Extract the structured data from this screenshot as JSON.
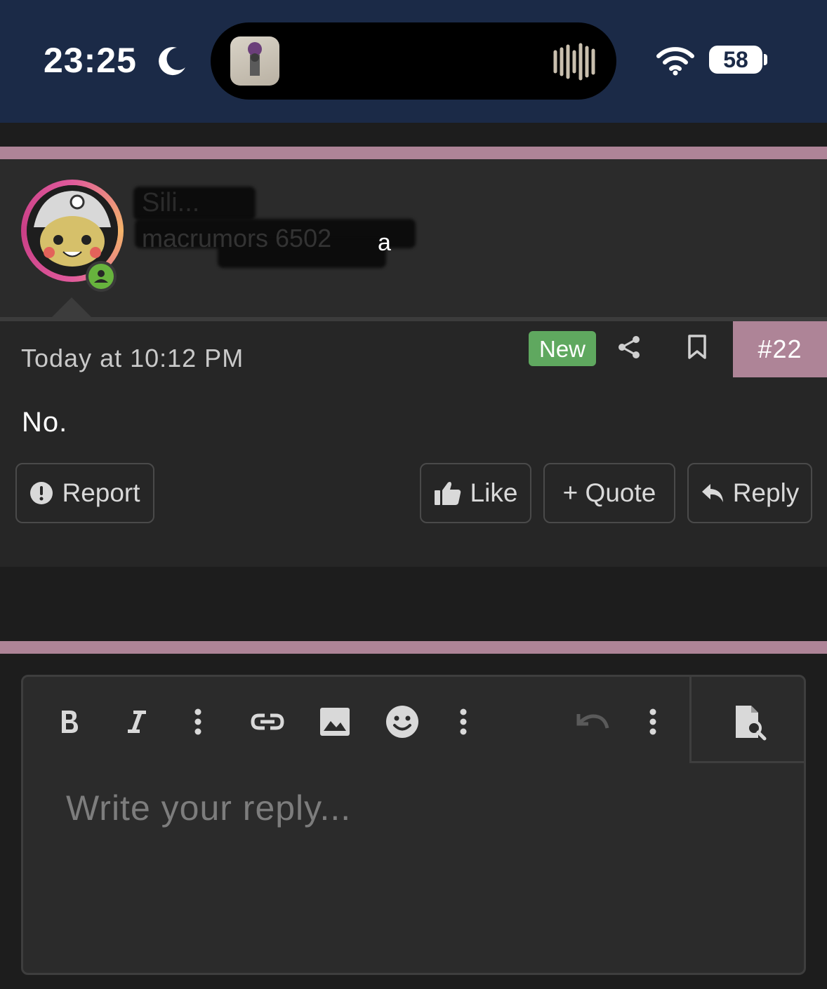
{
  "status_bar": {
    "time": "23:25",
    "battery": "58"
  },
  "post": {
    "username": "Sili...",
    "user_title": "macrumors 6502",
    "user_title_tail": "a",
    "date": "Today at 10:12 PM",
    "new_badge": "New",
    "post_number": "#22",
    "message": "No."
  },
  "actions": {
    "report": "Report",
    "like": "Like",
    "quote": "+ Quote",
    "reply": "Reply"
  },
  "editor": {
    "placeholder": "Write your reply..."
  },
  "colors": {
    "status_bg": "#1b2a47",
    "accent_pink": "#ae8497",
    "new_badge": "#5fa85f",
    "online": "#67b33d"
  }
}
